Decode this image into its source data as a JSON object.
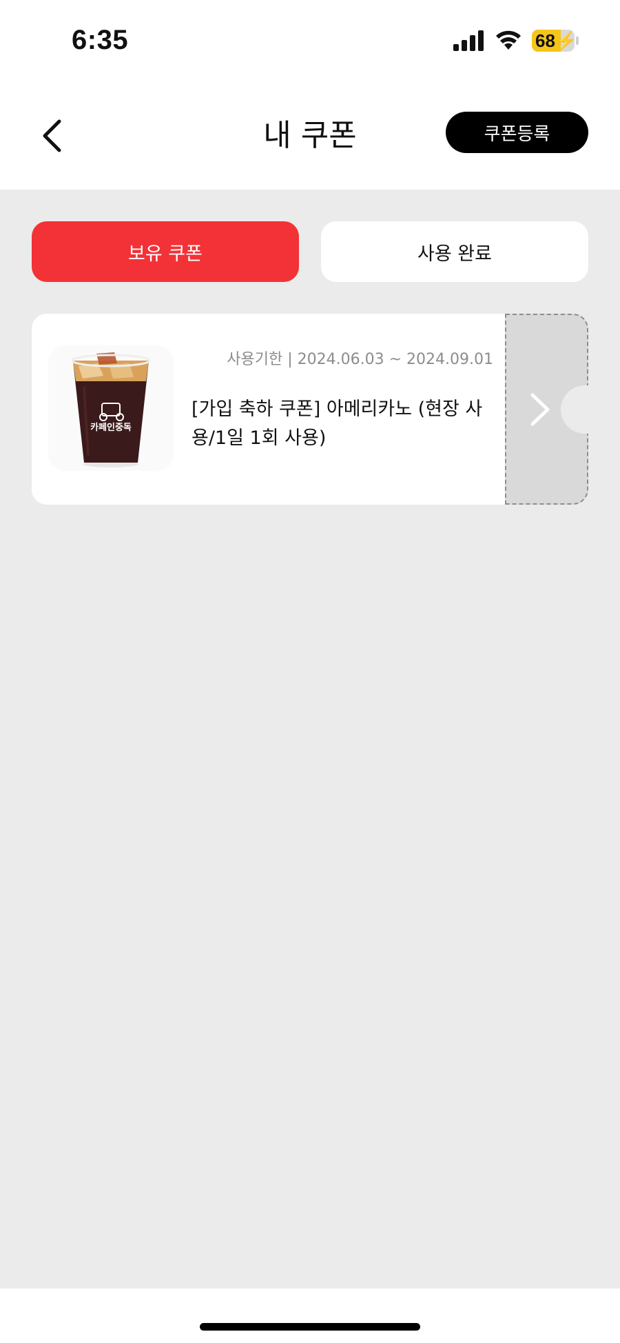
{
  "status_bar": {
    "time": "6:35",
    "battery_level": 68,
    "battery_text": "68",
    "icons": [
      "cellular-signal-icon",
      "wifi-icon",
      "battery-charging-icon"
    ]
  },
  "header": {
    "title": "내 쿠폰",
    "register_label": "쿠폰등록"
  },
  "tabs": [
    {
      "label": "보유 쿠폰",
      "active": true
    },
    {
      "label": "사용 완료",
      "active": false
    }
  ],
  "coupons": [
    {
      "period": "사용기한 | 2024.06.03 ~ 2024.09.01",
      "title": "[가입 축하 쿠폰] 아메리카노 (현장 사용/1일 1회 사용)",
      "image_label": "카페인중독"
    }
  ],
  "colors": {
    "accent": "#f23237",
    "background": "#ebebeb",
    "stub": "#d9d9d9"
  }
}
